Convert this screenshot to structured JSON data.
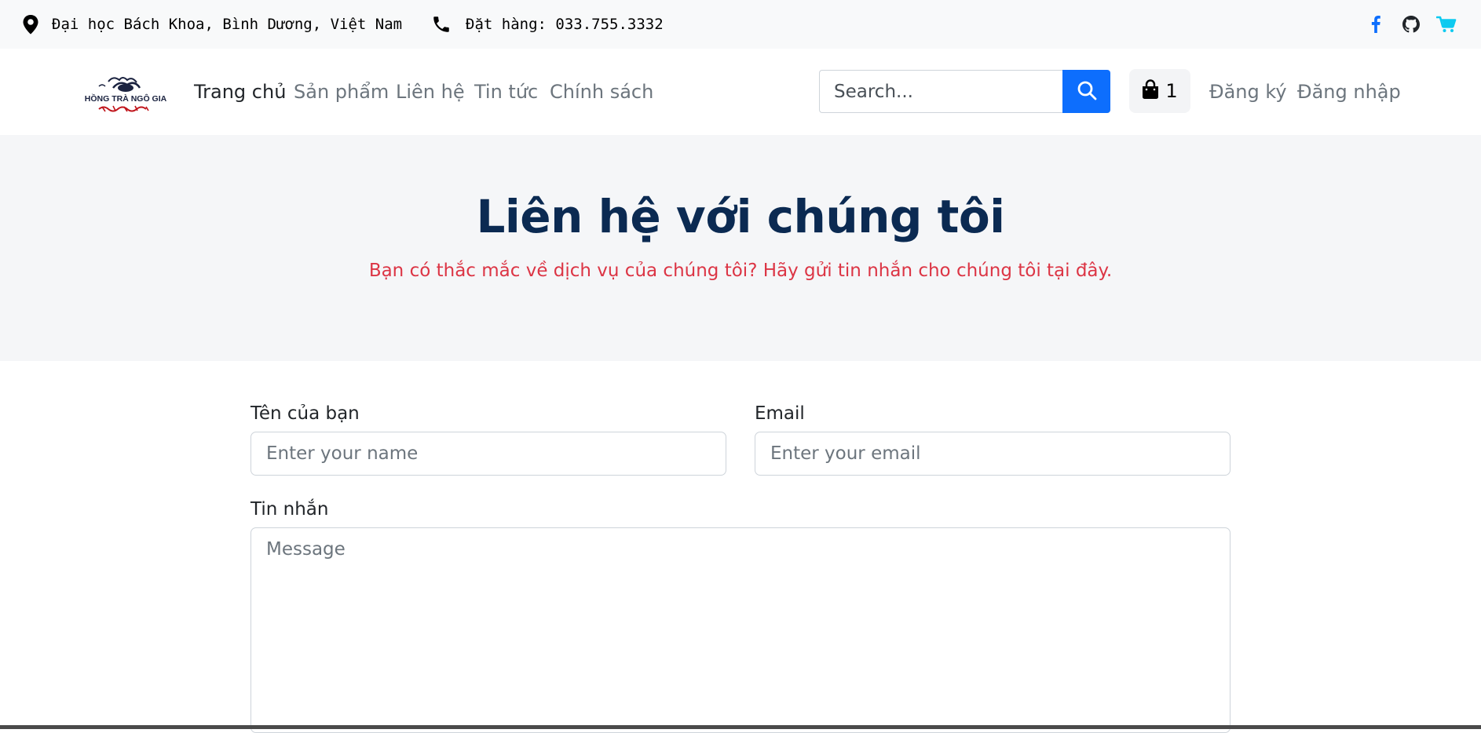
{
  "topbar": {
    "address": "Đại học Bách Khoa, Bình Dương, Việt Nam",
    "order_phone": "Đặt hàng: 033.755.3332",
    "icons": [
      "location-pin-icon",
      "phone-icon",
      "facebook-icon",
      "github-icon",
      "cart-icon"
    ],
    "colors": {
      "facebook": "#0d6efd",
      "github": "#212529",
      "cart": "#0dcaf0"
    }
  },
  "navbar": {
    "logo_text": "HỒNG TRÀ NGÔ GIA",
    "links": [
      "Trang chủ",
      "Sản phẩm",
      "Liên hệ",
      "Tin tức",
      "Chính sách"
    ],
    "active_link": "Trang chủ",
    "search": {
      "placeholder": "Search..."
    },
    "cart": {
      "count": "1"
    },
    "register": "Đăng ký",
    "login": "Đăng nhập"
  },
  "hero": {
    "title": "Liên hệ với chúng tôi",
    "subtitle": "Bạn có thắc mắc về dịch vụ của chúng tôi? Hãy gửi tin nhắn cho chúng tôi tại đây."
  },
  "form": {
    "name_label": "Tên của bạn",
    "name_placeholder": "Enter your name",
    "email_label": "Email",
    "email_placeholder": "Enter your email",
    "message_label": "Tin nhắn",
    "message_placeholder": "Message"
  },
  "colors": {
    "primary": "#0d6efd",
    "title": "#0b2a52",
    "subtitle": "#dc3545",
    "hero_bg": "#f5f6f8"
  }
}
